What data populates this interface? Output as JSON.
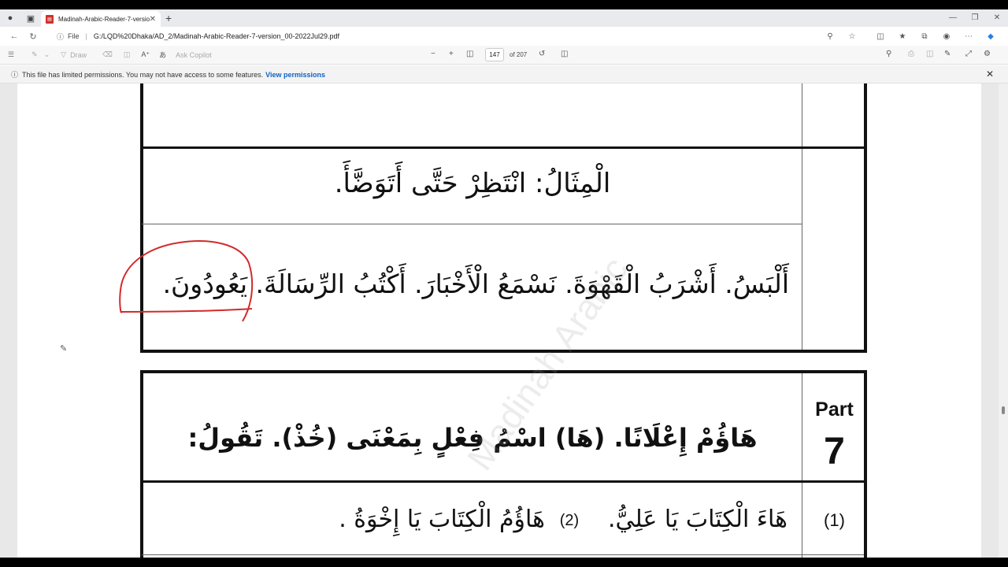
{
  "tab": {
    "title": "Madinah-Arabic-Reader-7-version"
  },
  "address": {
    "scheme_label": "File",
    "url": "G:/LQD%20Dhaka/AD_2/Madinah-Arabic-Reader-7-version_00-2022Jul29.pdf"
  },
  "toolbar": {
    "draw_label": "Draw",
    "copilot_label": "Ask Copilot",
    "page_current": "147",
    "page_total": "of 207"
  },
  "notice": {
    "text": "This file has limited permissions. You may not have access to some features.",
    "link": "View permissions"
  },
  "doc": {
    "example": "الْمِثَالُ: انْتَظِرْ حَتَّى أَتَوَضَّأَ.",
    "sentences": "أَلْبَسُ. أَشْرَبُ الْقَهْوَةَ. نَسْمَعُ الْأَخْبَارَ. أَكْتُبُ الرِّسَالَةَ. يَعُودُونَ.",
    "part_label": "Part",
    "part_number": "7",
    "part_heading": "هَاؤُمْ إِعْلَانًا. (هَا) اسْمُ فِعْلٍ بِمَعْنَى (خُذْ). تَقُولُ:",
    "item_number": "(1)",
    "item_text_a": "هَاءَ الْكِتَابَ يَا عَلِيُّ.",
    "item_marker_2": "(2)",
    "item_text_b": "هَاؤُمُ الْكِتَابَ يَا إِخْوَةُ .",
    "watermark": "Madinah Arabic"
  },
  "colors": {
    "annotation": "#d32a2a",
    "link": "#0e62c7"
  }
}
